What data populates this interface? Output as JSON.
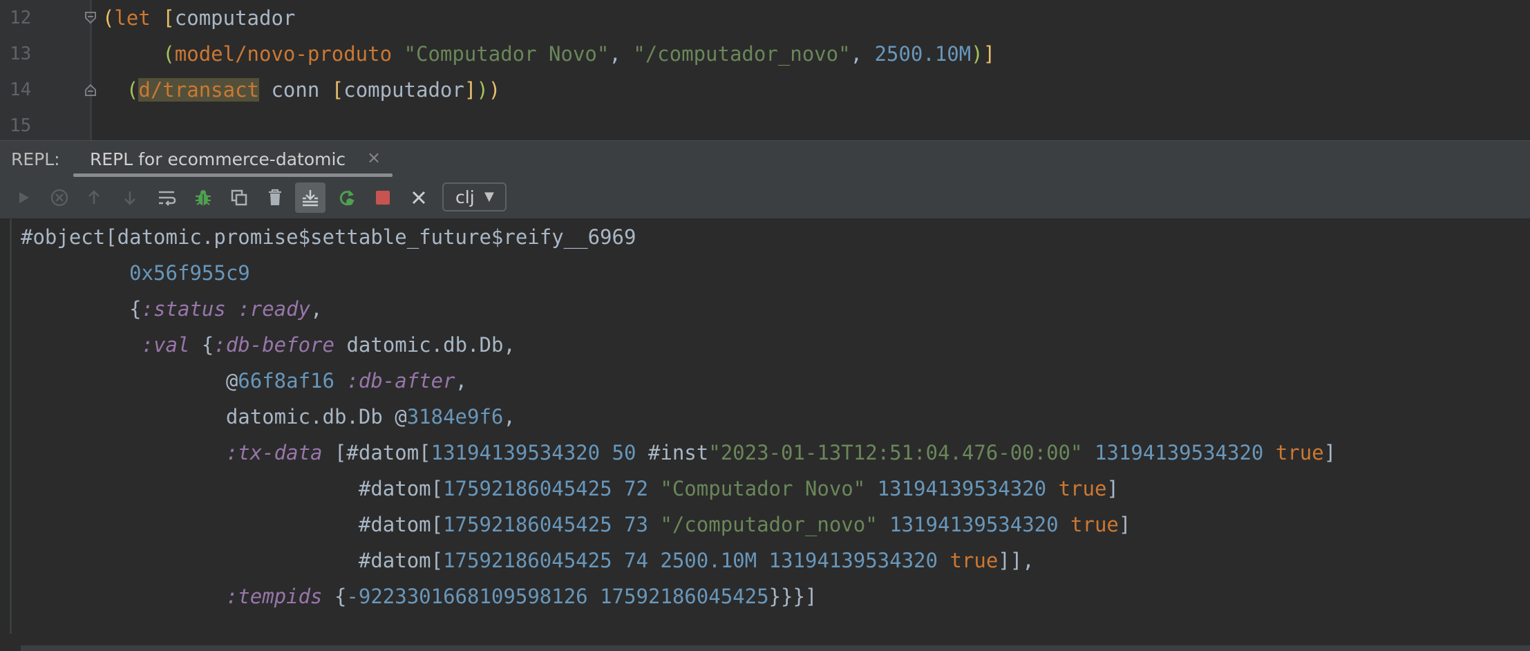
{
  "editor": {
    "line_numbers": [
      "12",
      "13",
      "14",
      "15"
    ],
    "lines": [
      {
        "indent": "",
        "tokens": [
          {
            "t": "(",
            "c": "p1"
          },
          {
            "t": "let",
            "c": "kw"
          },
          {
            "t": " "
          },
          {
            "t": "[",
            "c": "p1"
          },
          {
            "t": "computador"
          }
        ]
      },
      {
        "indent": "     ",
        "tokens": [
          {
            "t": "(",
            "c": "p2"
          },
          {
            "t": "model/novo-produto",
            "c": "kw"
          },
          {
            "t": " "
          },
          {
            "t": "\"Computador Novo\"",
            "c": "str"
          },
          {
            "t": ", "
          },
          {
            "t": "\"/computador_novo\"",
            "c": "str"
          },
          {
            "t": ", "
          },
          {
            "t": "2500.10M",
            "c": "num"
          },
          {
            "t": ")",
            "c": "p2"
          },
          {
            "t": "]",
            "c": "p1"
          }
        ]
      },
      {
        "indent": "  ",
        "tokens": [
          {
            "t": "(",
            "c": "p2"
          },
          {
            "t": "d/transact",
            "c": "kw hl"
          },
          {
            "t": " conn "
          },
          {
            "t": "[",
            "c": "p1"
          },
          {
            "t": "computador"
          },
          {
            "t": "]",
            "c": "p1"
          },
          {
            "t": ")",
            "c": "p2"
          },
          {
            "t": ")",
            "c": "p1"
          }
        ]
      }
    ]
  },
  "repl": {
    "label": "REPL:",
    "tab_title": "REPL for ecommerce-datomic",
    "tab_close": "×",
    "ns_select": "clj",
    "toolbar_icons": [
      "run-icon",
      "interrupt-icon",
      "history-up-icon",
      "history-down-icon",
      "soft-wrap-icon",
      "debug-icon",
      "copy-icon",
      "clear-icon",
      "scroll-to-end-icon",
      "reload-icon",
      "stop-icon",
      "close-icon"
    ]
  },
  "output": [
    {
      "indent": "",
      "tokens": [
        {
          "t": "#object[datomic.promise$settable_future$reify__6969"
        }
      ]
    },
    {
      "indent": "         ",
      "tokens": [
        {
          "t": "0x56f955c9",
          "c": "num"
        }
      ]
    },
    {
      "indent": "         ",
      "tokens": [
        {
          "t": "{"
        },
        {
          "t": ":status",
          "c": "kwd"
        },
        {
          "t": " "
        },
        {
          "t": ":ready",
          "c": "kwd"
        },
        {
          "t": ","
        }
      ]
    },
    {
      "indent": "          ",
      "tokens": [
        {
          "t": ":val",
          "c": "kwd"
        },
        {
          "t": " {"
        },
        {
          "t": ":db-before",
          "c": "kwd"
        },
        {
          "t": " datomic.db.Db,"
        }
      ]
    },
    {
      "indent": "                 ",
      "tokens": [
        {
          "t": "@"
        },
        {
          "t": "66f8af16",
          "c": "num"
        },
        {
          "t": " "
        },
        {
          "t": ":db-after",
          "c": "kwd"
        },
        {
          "t": ","
        }
      ]
    },
    {
      "indent": "                 ",
      "tokens": [
        {
          "t": "datomic.db.Db @"
        },
        {
          "t": "3184e9f6",
          "c": "num"
        },
        {
          "t": ","
        }
      ]
    },
    {
      "indent": "                 ",
      "tokens": [
        {
          "t": ":tx-data",
          "c": "kwd"
        },
        {
          "t": " [#datom["
        },
        {
          "t": "13194139534320",
          "c": "num"
        },
        {
          "t": " "
        },
        {
          "t": "50",
          "c": "num"
        },
        {
          "t": " #inst"
        },
        {
          "t": "\"2023-01-13T12:51:04.476-00:00\"",
          "c": "str"
        },
        {
          "t": " "
        },
        {
          "t": "13194139534320",
          "c": "num"
        },
        {
          "t": " "
        },
        {
          "t": "true",
          "c": "bool"
        },
        {
          "t": "]"
        }
      ]
    },
    {
      "indent": "                            ",
      "tokens": [
        {
          "t": "#datom["
        },
        {
          "t": "17592186045425",
          "c": "num"
        },
        {
          "t": " "
        },
        {
          "t": "72",
          "c": "num"
        },
        {
          "t": " "
        },
        {
          "t": "\"Computador Novo\"",
          "c": "str"
        },
        {
          "t": " "
        },
        {
          "t": "13194139534320",
          "c": "num"
        },
        {
          "t": " "
        },
        {
          "t": "true",
          "c": "bool"
        },
        {
          "t": "]"
        }
      ]
    },
    {
      "indent": "                            ",
      "tokens": [
        {
          "t": "#datom["
        },
        {
          "t": "17592186045425",
          "c": "num"
        },
        {
          "t": " "
        },
        {
          "t": "73",
          "c": "num"
        },
        {
          "t": " "
        },
        {
          "t": "\"/computador_novo\"",
          "c": "str"
        },
        {
          "t": " "
        },
        {
          "t": "13194139534320",
          "c": "num"
        },
        {
          "t": " "
        },
        {
          "t": "true",
          "c": "bool"
        },
        {
          "t": "]"
        }
      ]
    },
    {
      "indent": "                            ",
      "tokens": [
        {
          "t": "#datom["
        },
        {
          "t": "17592186045425",
          "c": "num"
        },
        {
          "t": " "
        },
        {
          "t": "74",
          "c": "num"
        },
        {
          "t": " "
        },
        {
          "t": "2500.10M",
          "c": "num"
        },
        {
          "t": " "
        },
        {
          "t": "13194139534320",
          "c": "num"
        },
        {
          "t": " "
        },
        {
          "t": "true",
          "c": "bool"
        },
        {
          "t": "]],"
        }
      ]
    },
    {
      "indent": "                 ",
      "tokens": [
        {
          "t": ":tempids",
          "c": "kwd"
        },
        {
          "t": " {"
        },
        {
          "t": "-9223301668109598126",
          "c": "num"
        },
        {
          "t": " "
        },
        {
          "t": "17592186045425",
          "c": "num"
        },
        {
          "t": "}}}]"
        }
      ]
    }
  ],
  "colors": {
    "background": "#2b2b2b",
    "keyword": "#cc7832",
    "string": "#6a8759",
    "number": "#6897bb",
    "clj_keyword": "#9876aa",
    "text": "#a9b7c6"
  }
}
